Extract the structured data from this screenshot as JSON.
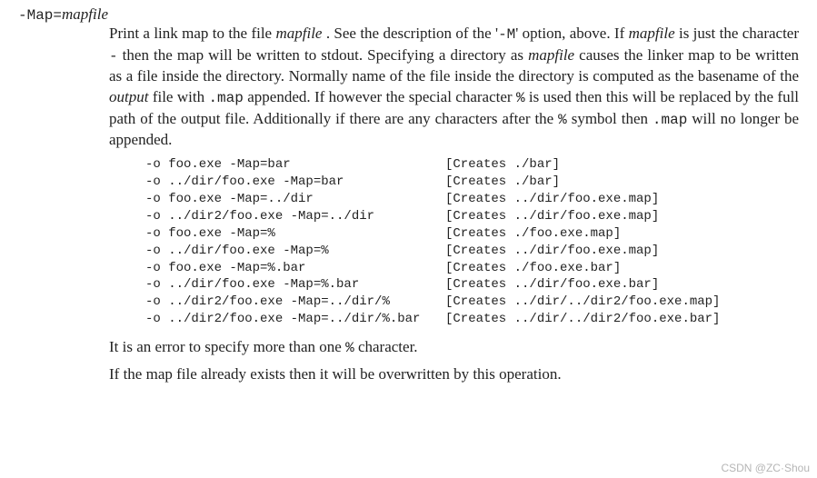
{
  "option": {
    "prefix": "-Map=",
    "arg": "mapfile"
  },
  "desc": {
    "p1_a": "Print a link map to the file ",
    "p1_mapfile": "mapfile",
    "p1_b": ".  See the description of the '",
    "p1_M": "-M",
    "p1_c": "' option, above. If ",
    "p1_mapfile2": "mapfile",
    "p1_d": " is just the character ",
    "p1_dash": "-",
    "p1_e": " then the map will be written to stdout. Specifying a directory as ",
    "p1_mapfile3": "mapfile",
    "p1_f": " causes the linker map to be written as a file inside the directory.  Normally name of the file inside the directory is computed as the basename of the ",
    "p1_output": "output",
    "p1_g": " file with ",
    "p1_map_ext": ".map",
    "p1_h": " appended. If however the special character ",
    "p1_pct1": "%",
    "p1_i": " is used then this will be replaced by the full path of the output file. Additionally if there are any characters after the ",
    "p1_pct2": "%",
    "p1_j": " symbol then ",
    "p1_map_ext2": ".map",
    "p1_k": " will no longer be appended."
  },
  "examples": [
    {
      "cmd": "-o foo.exe -Map=bar",
      "out": "[Creates ./bar]"
    },
    {
      "cmd": "-o ../dir/foo.exe -Map=bar",
      "out": "[Creates ./bar]"
    },
    {
      "cmd": "-o foo.exe -Map=../dir",
      "out": "[Creates ../dir/foo.exe.map]"
    },
    {
      "cmd": "-o ../dir2/foo.exe -Map=../dir",
      "out": "[Creates ../dir/foo.exe.map]"
    },
    {
      "cmd": "-o foo.exe -Map=%",
      "out": "[Creates ./foo.exe.map]"
    },
    {
      "cmd": "-o ../dir/foo.exe -Map=%",
      "out": "[Creates ../dir/foo.exe.map]"
    },
    {
      "cmd": "-o foo.exe -Map=%.bar",
      "out": "[Creates ./foo.exe.bar]"
    },
    {
      "cmd": "-o ../dir/foo.exe -Map=%.bar",
      "out": "[Creates ../dir/foo.exe.bar]"
    },
    {
      "cmd": "-o ../dir2/foo.exe -Map=../dir/%",
      "out": "[Creates ../dir/../dir2/foo.exe.map]"
    },
    {
      "cmd": "-o ../dir2/foo.exe -Map=../dir/%.bar",
      "out": "[Creates ../dir/../dir2/foo.exe.bar]"
    }
  ],
  "tail": {
    "p2_a": "It is an error to specify more than one ",
    "p2_pct": "%",
    "p2_b": " character.",
    "p3": "If the map file already exists then it will be overwritten by this operation."
  },
  "watermark": "CSDN @ZC·Shou"
}
